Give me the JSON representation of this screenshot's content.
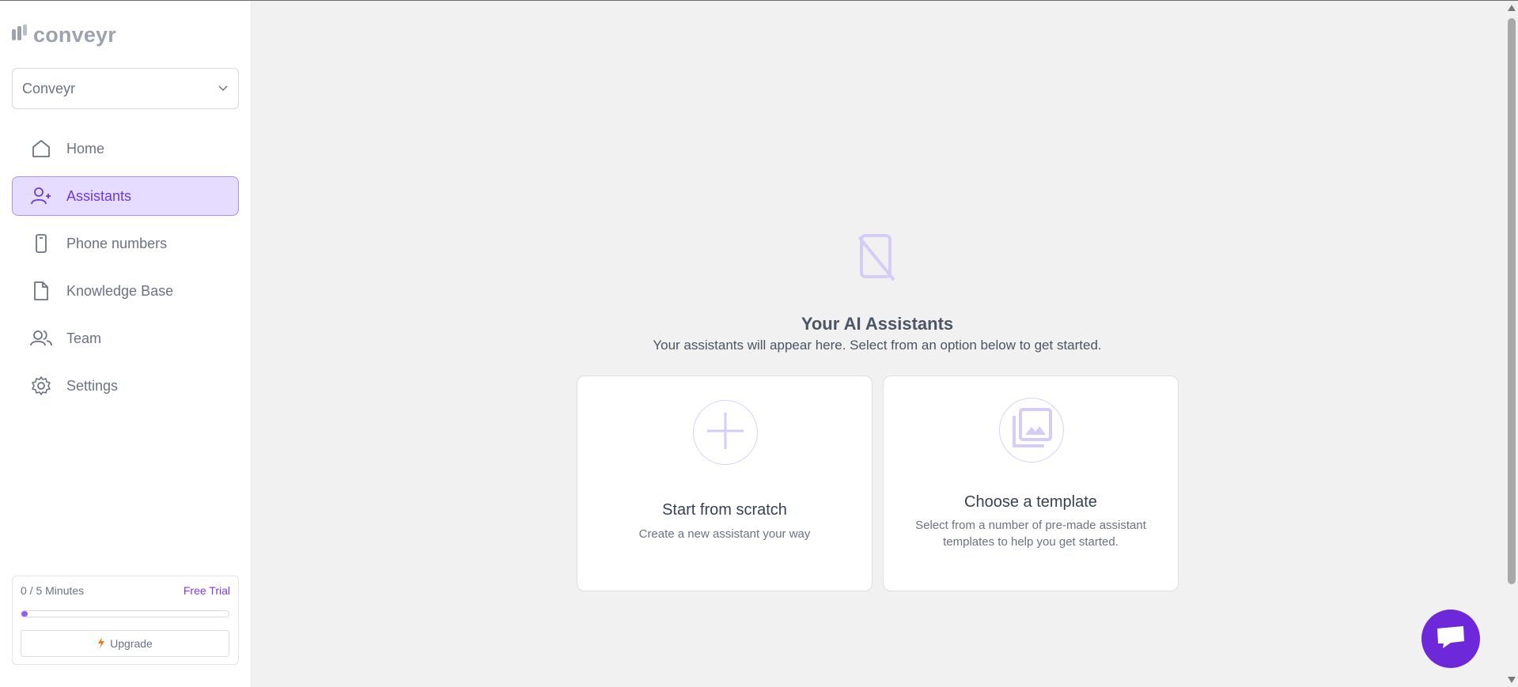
{
  "brand": {
    "name": "conveyr",
    "icon": "conveyr-logo-icon"
  },
  "org_select": {
    "value": "Conveyr",
    "icon": "chevron-down-icon"
  },
  "nav": {
    "items": [
      {
        "label": "Home",
        "icon": "home-icon",
        "active": false
      },
      {
        "label": "Assistants",
        "icon": "user-plus-icon",
        "active": true
      },
      {
        "label": "Phone numbers",
        "icon": "phone-icon",
        "active": false
      },
      {
        "label": "Knowledge Base",
        "icon": "document-icon",
        "active": false
      },
      {
        "label": "Team",
        "icon": "team-icon",
        "active": false
      },
      {
        "label": "Settings",
        "icon": "gear-icon",
        "active": false
      }
    ]
  },
  "usage": {
    "minutes_label": "0 / 5 Minutes",
    "plan": "Free Trial",
    "progress_fraction": 0.03,
    "upgrade_label": "Upgrade",
    "upgrade_icon": "lightning-icon"
  },
  "main": {
    "empty_icon": "phone-off-icon",
    "title": "Your AI Assistants",
    "subtitle": "Your assistants will appear here. Select from an option below to get started."
  },
  "cards": [
    {
      "title": "Start from scratch",
      "description": "Create a new assistant your way",
      "icon": "plus-icon"
    },
    {
      "title": "Choose a template",
      "description": "Select from a number of pre-made  assistant templates to help you get started.",
      "icon": "image-stack-icon"
    }
  ],
  "chat": {
    "icon": "chat-icon"
  },
  "colors": {
    "accent": "#6d3bd6",
    "active_bg": "#e6dcff",
    "chat_bg": "#6d28d9",
    "background": "#f0f1f0"
  }
}
